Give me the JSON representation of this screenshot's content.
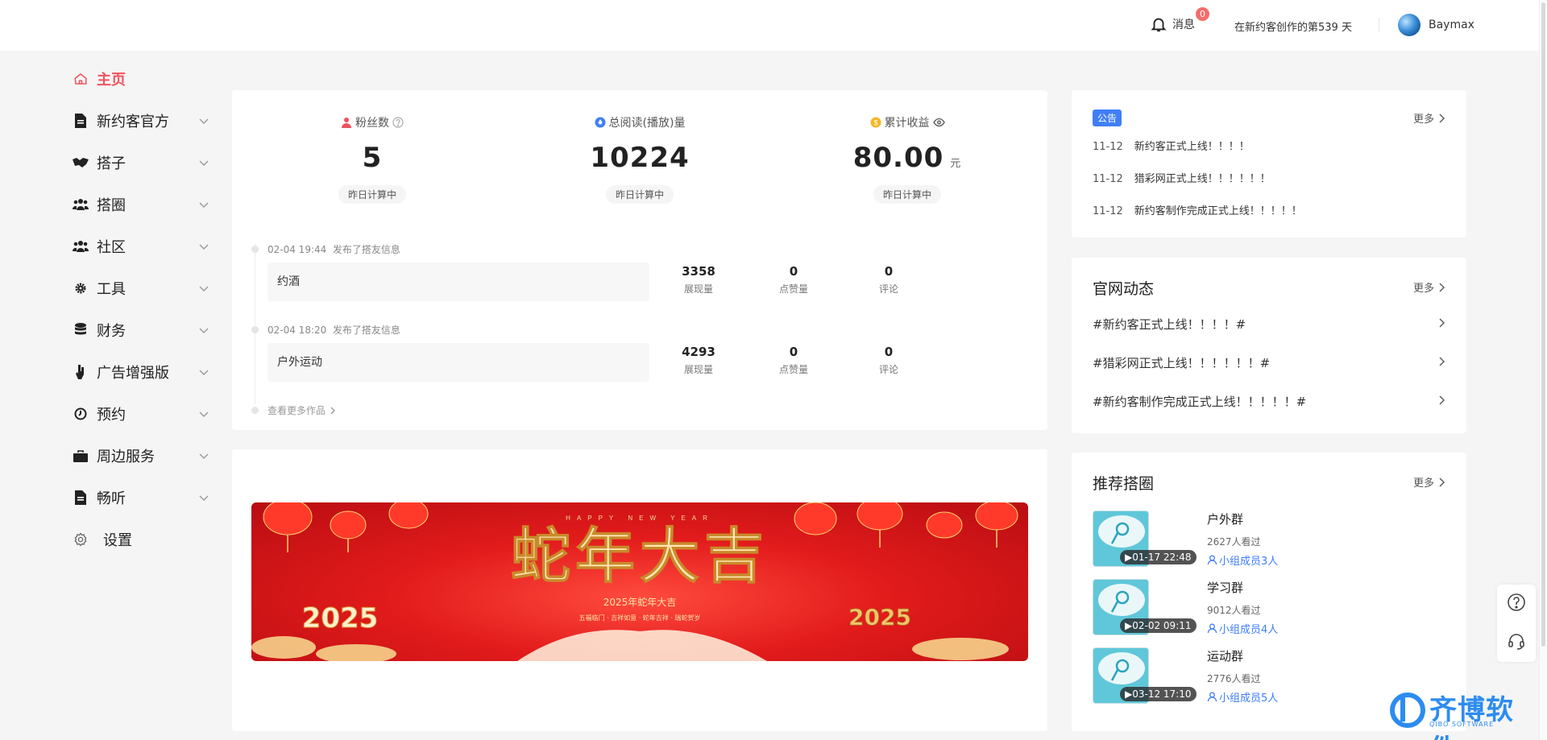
{
  "header": {
    "messages_label": "消息",
    "messages_count": "0",
    "days_text": "在新约客创作的第539 天",
    "username": "Baymax"
  },
  "sidebar": {
    "items": [
      {
        "label": "主页",
        "icon": "home-icon",
        "active": true
      },
      {
        "label": "新约客官方",
        "icon": "document-icon"
      },
      {
        "label": "搭子",
        "icon": "handshake-icon"
      },
      {
        "label": "搭圈",
        "icon": "users-icon"
      },
      {
        "label": "社区",
        "icon": "users-icon"
      },
      {
        "label": "工具",
        "icon": "gear-icon"
      },
      {
        "label": "财务",
        "icon": "database-icon"
      },
      {
        "label": "广告增强版",
        "icon": "hand-icon"
      },
      {
        "label": "预约",
        "icon": "clock-icon"
      },
      {
        "label": "周边服务",
        "icon": "bag-icon"
      },
      {
        "label": "畅听",
        "icon": "document-icon"
      },
      {
        "label": "设置",
        "icon": "settings-icon"
      }
    ]
  },
  "stats": {
    "fans": {
      "label": "粉丝数",
      "value": "5",
      "note": "昨日计算中"
    },
    "reads": {
      "label": "总阅读(播放)量",
      "value": "10224",
      "note": "昨日计算中"
    },
    "income": {
      "label": "累计收益",
      "value": "80.00",
      "unit": "元",
      "note": "昨日计算中"
    }
  },
  "posts": [
    {
      "time": "02-04 19:44",
      "action": "发布了搭友信息",
      "title": "约酒",
      "views": "3358",
      "views_label": "展现量",
      "likes": "0",
      "likes_label": "点赞量",
      "comments": "0",
      "comments_label": "评论"
    },
    {
      "time": "02-04 18:20",
      "action": "发布了搭友信息",
      "title": "户外运动",
      "views": "4293",
      "views_label": "展现量",
      "likes": "0",
      "likes_label": "点赞量",
      "comments": "0",
      "comments_label": "评论"
    }
  ],
  "more_works": "查看更多作品",
  "banner": {
    "title": "蛇年大吉",
    "header_text": "HAPPY NEW YEAR",
    "subtitle": "2025年蛇年大吉",
    "tagline": "五福临门 · 吉祥如意 · 蛇年吉祥 · 瑞蛇贺岁",
    "year": "2025"
  },
  "notice": {
    "tag": "公告",
    "more": "更多",
    "items": [
      {
        "date": "11-12",
        "text": "新约客正式上线！！！！"
      },
      {
        "date": "11-12",
        "text": "猎彩网正式上线！！！！！！"
      },
      {
        "date": "11-12",
        "text": "新约客制作完成正式上线！！！！！"
      }
    ]
  },
  "news": {
    "title": "官网动态",
    "more": "更多",
    "items": [
      "#新约客正式上线！！！！#",
      "#猎彩网正式上线！！！！！！#",
      "#新约客制作完成正式上线！！！！！#"
    ]
  },
  "circles": {
    "title": "推荐搭圈",
    "more": "更多",
    "items": [
      {
        "name": "户外群",
        "views": "2627人看过",
        "members": "小组成员3人",
        "time": "01-17 22:48"
      },
      {
        "name": "学习群",
        "views": "9012人看过",
        "members": "小组成员4人",
        "time": "02-02 09:11"
      },
      {
        "name": "运动群",
        "views": "2776人看过",
        "members": "小组成员5人",
        "time": "03-12 17:10"
      }
    ]
  },
  "watermark": {
    "text": "齐博软件",
    "sub": "QIBO SOFTWARE"
  },
  "colors": {
    "accent": "#f0525f",
    "primary": "#3f7ef7",
    "badge": "#f56c6c"
  }
}
